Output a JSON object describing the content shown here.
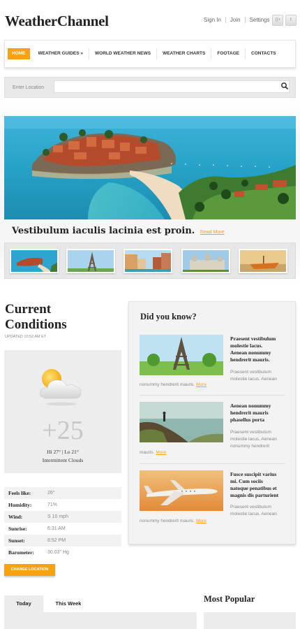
{
  "header": {
    "logo": "WeatherChannel",
    "links": [
      "Sign In",
      "Join",
      "Settings"
    ],
    "social": [
      {
        "icon": "rss-icon",
        "glyph": "((•"
      },
      {
        "icon": "twitter-icon",
        "glyph": "t"
      }
    ]
  },
  "nav": {
    "items": [
      "HOME",
      "WEATHER GUIDES »",
      "WORLD WEATHER NEWS",
      "WEATHER CHARTS",
      "FOOTAGE",
      "CONTACTS"
    ],
    "active_index": 0
  },
  "search": {
    "label": "Enter Location",
    "placeholder": ""
  },
  "hero": {
    "caption": "Vestibulum iaculis lacinia est proin.",
    "read_more": "Read More",
    "thumbnails": [
      "coast-thumb",
      "eiffel-tower-thumb",
      "venice-canal-thumb",
      "castle-thumb",
      "boat-thumb"
    ]
  },
  "current": {
    "title_line1": "Current",
    "title_line2": "Conditions",
    "updated": "UPDATED 10:52 AM ET",
    "weather_icon": "partly-cloudy-icon",
    "temp": "+25",
    "hilo": "Hi 27° | Lo 21°",
    "condition": "Intermittent Clouds",
    "stats": [
      {
        "label": "Feels like:",
        "value": "26°"
      },
      {
        "label": "Humidity:",
        "value": "71%"
      },
      {
        "label": "Wind:",
        "value": "S 10 mph"
      },
      {
        "label": "Sunrise:",
        "value": "6:31 AM"
      },
      {
        "label": "Sunset:",
        "value": "8:52 PM"
      },
      {
        "label": "Barometer:",
        "value": "30.03\" Hg"
      }
    ],
    "change_button": "CHANGE LOCATION"
  },
  "did_you_know": {
    "title": "Did you know?",
    "items": [
      {
        "image": "eiffel-tower-image",
        "heading": [
          "Praesent vestibulum",
          "molestie lacus.",
          "Aenean nonummy",
          "hendrerit mauris."
        ],
        "sub": [
          "Praesent vestibulum",
          "molestie lacus. Aenean"
        ],
        "tail": "nonummy hendrerit mauris.",
        "more": "More"
      },
      {
        "image": "hiker-cliff-image",
        "heading": [
          "Aenean nonummy",
          "hendrerit mauris",
          "phasellus porta"
        ],
        "sub": [
          "Praesent vestibulum",
          "molestie lacus. Aenean",
          "nonummy hendrerit"
        ],
        "tail": "mauris.",
        "more": "More"
      },
      {
        "image": "airplane-image",
        "heading": [
          "Fusce suscipit varius",
          "mi. Cum sociis",
          "natoque penatibus et",
          "magnis dis parturient"
        ],
        "sub": [
          "Praesent vestibulum",
          "molestie lacus. Aenean"
        ],
        "tail": "nonummy hendrerit mauris.",
        "more": "More"
      }
    ]
  },
  "bottom": {
    "tabs": [
      "Today",
      "This Week"
    ],
    "active_tab": 0,
    "most_popular": "Most Popular"
  }
}
